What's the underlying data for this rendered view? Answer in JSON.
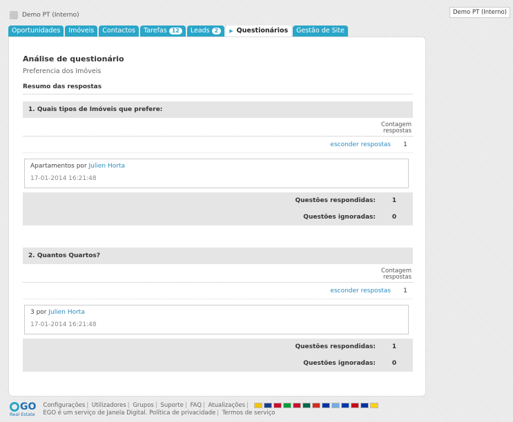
{
  "header": {
    "app_name": "Demo PT (Interno)",
    "account_label": "Demo PT (Interno)"
  },
  "tabs": [
    {
      "label": "Oportunidades",
      "badge": null,
      "active": false
    },
    {
      "label": "Imóveis",
      "badge": null,
      "active": false
    },
    {
      "label": "Contactos",
      "badge": null,
      "active": false
    },
    {
      "label": "Tarefas",
      "badge": "12",
      "active": false
    },
    {
      "label": "Leads",
      "badge": "2",
      "active": false
    },
    {
      "label": "Questionários",
      "badge": null,
      "active": true
    },
    {
      "label": "Gestão de Site",
      "badge": null,
      "active": false
    }
  ],
  "main": {
    "title": "Análise de questionário",
    "subtitle": "Preferencia dos Imóveis",
    "summary_heading": "Resumo das respostas",
    "questions": [
      {
        "title": "1. Quais tipos de Imóveis que prefere:",
        "count_header_line1": "Contagem",
        "count_header_line2": "respostas",
        "hide_link": "esconder respostas",
        "count": "1",
        "answer_text": "Apartamentos por ",
        "answer_user": "Julien Horta",
        "answer_date": "17-01-2014 16:21:48",
        "answered_label": "Questões respondidas:",
        "answered_value": "1",
        "ignored_label": "Questões ignoradas:",
        "ignored_value": "0"
      },
      {
        "title": "2. Quantos Quartos?",
        "count_header_line1": "Contagem",
        "count_header_line2": "respostas",
        "hide_link": "esconder respostas",
        "count": "1",
        "answer_text": "3 por ",
        "answer_user": "Julien Horta",
        "answer_date": "17-01-2014 16:21:48",
        "answered_label": "Questões respondidas:",
        "answered_value": "1",
        "ignored_label": "Questões ignoradas:",
        "ignored_value": "0"
      }
    ]
  },
  "footer": {
    "links": [
      "Configurações",
      "Utilizadores",
      "Grupos",
      "Suporte",
      "FAQ",
      "Atualizações"
    ],
    "line2_prefix": "EGO é um serviço de Janela Digital.",
    "privacy": "Política de privacidade",
    "terms": "Termos de serviço",
    "logo_text": "GO",
    "logo_sub": "Real Estate",
    "flag_colors": [
      "#f5c400",
      "#1a3e8c",
      "#c8102e",
      "#009c3b",
      "#c8102e",
      "#006847",
      "#d52b1e",
      "#0032a0",
      "#74acdf",
      "#0038a8",
      "#c60b1e",
      "#0033a0",
      "#fcd116"
    ]
  }
}
